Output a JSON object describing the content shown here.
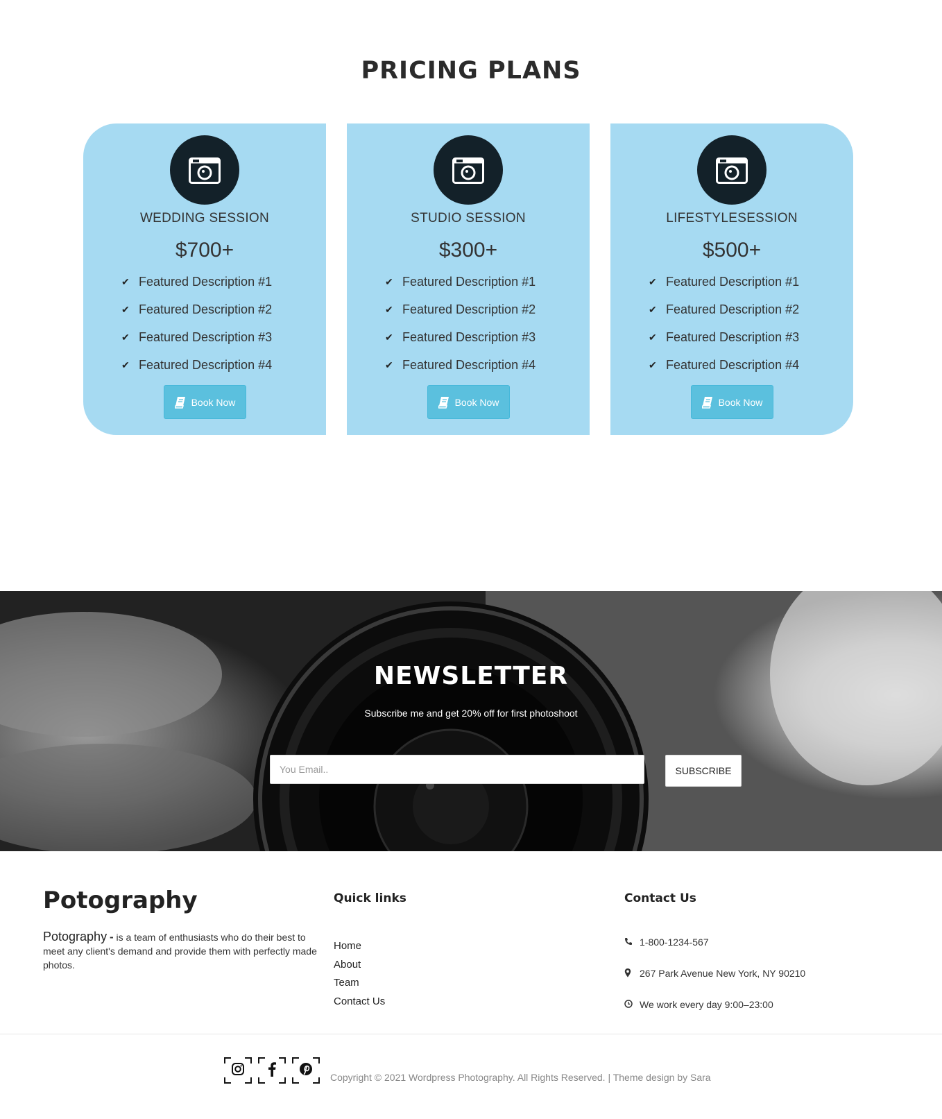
{
  "pricing": {
    "title": "PRICING PLANS",
    "plans": [
      {
        "icon": "camera-icon",
        "name": "WEDDING SESSION",
        "price": "$700+",
        "features": [
          "Featured Description #1",
          "Featured Description #2",
          "Featured Description #3",
          "Featured Description #4"
        ],
        "button": "Book Now"
      },
      {
        "icon": "camera-icon",
        "name": "STUDIO SESSION",
        "price": "$300+",
        "features": [
          "Featured Description #1",
          "Featured Description #2",
          "Featured Description #3",
          "Featured Description #4"
        ],
        "button": "Book Now"
      },
      {
        "icon": "camera-icon",
        "name": "LIFESTYLESESSION",
        "price": "$500+",
        "features": [
          "Featured Description #1",
          "Featured Description #2",
          "Featured Description #3",
          "Featured Description #4"
        ],
        "button": "Book Now"
      }
    ],
    "colors": {
      "card": "#a6daf2",
      "icon_circle": "#132129",
      "button": "#5bc0de"
    }
  },
  "newsletter": {
    "title": "NEWSLETTER",
    "subtitle": "Subscribe me and get 20% off for first photoshoot",
    "email_placeholder": "You Email..",
    "subscribe_label": "SUBSCRIBE"
  },
  "footer": {
    "brand": "Potography",
    "about_brand": "Potography",
    "about_dash": "-",
    "about_text": " is a team of enthusiasts who do their best to meet any client's demand and provide them with perfectly made photos.",
    "quick_links_title": "Quick links",
    "quick_links": [
      "Home",
      "About",
      "Team",
      "Contact Us"
    ],
    "contact_title": "Contact Us",
    "contacts": [
      {
        "icon": "phone-icon",
        "text": "1-800-1234-567"
      },
      {
        "icon": "map-pin-icon",
        "text": "267 Park Avenue New York, NY 90210"
      },
      {
        "icon": "clock-icon",
        "text": "We work every day 9:00–23:00"
      }
    ],
    "socials": [
      "instagram-icon",
      "facebook-icon",
      "pinterest-icon"
    ],
    "copyright": "Copyright © 2021 Wordpress Photography. All Rights Reserved. | Theme design by Sara"
  }
}
